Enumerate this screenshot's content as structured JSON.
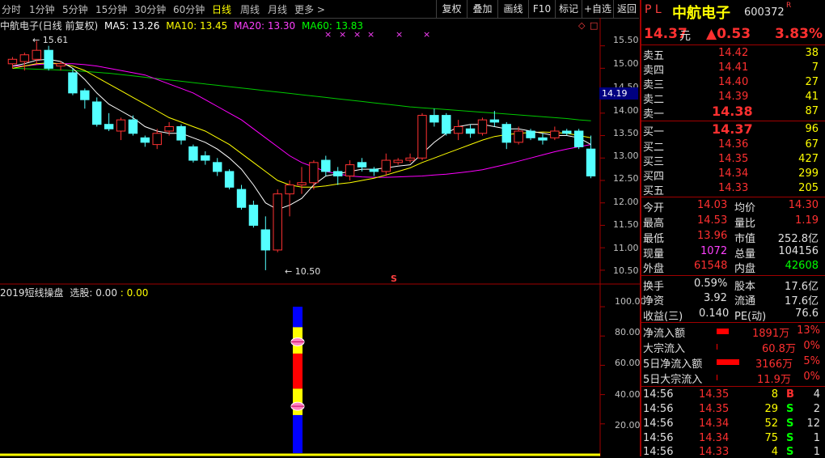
{
  "toolbar": {
    "periods": [
      "分时",
      "1分钟",
      "5分钟",
      "15分钟",
      "30分钟",
      "60分钟",
      "日线",
      "周线",
      "月线",
      "更多 >"
    ],
    "active_period": "日线",
    "buttons": [
      "复权",
      "叠加",
      "画线",
      "F10",
      "标记",
      "+自选",
      "返回"
    ]
  },
  "header": {
    "title": "中航电子(日线 前复权)",
    "ma5": "MA5: 13.26",
    "ma10": "MA10: 13.45",
    "ma20": "MA20: 13.30",
    "ma60": "MA60: 13.83",
    "colors": {
      "ma5": "#ffffff",
      "ma10": "#ffff00",
      "ma20": "#ff00ff",
      "ma60": "#00ff00"
    }
  },
  "chart_data": [
    {
      "type": "candlestick",
      "title": "中航电子(日线 前复权)",
      "ylim": [
        10.3,
        15.8
      ],
      "yticks": [
        10.5,
        11.0,
        11.5,
        12.0,
        12.5,
        13.0,
        13.5,
        14.0,
        14.5,
        15.0,
        15.5
      ],
      "current_price_marker": "14.19",
      "high_label": "15.61",
      "low_label": "10.50",
      "signal_marks": [
        "×",
        "×",
        "×",
        "×",
        "×",
        "×"
      ],
      "s_marker": "S",
      "candles": [
        {
          "o": 15.1,
          "h": 15.25,
          "l": 15.0,
          "c": 15.2
        },
        {
          "o": 15.15,
          "h": 15.35,
          "l": 14.95,
          "c": 15.3
        },
        {
          "o": 15.2,
          "h": 15.61,
          "l": 15.1,
          "c": 15.4
        },
        {
          "o": 15.4,
          "h": 15.5,
          "l": 14.95,
          "c": 15.0
        },
        {
          "o": 15.05,
          "h": 15.15,
          "l": 14.95,
          "c": 15.1
        },
        {
          "o": 14.9,
          "h": 15.0,
          "l": 14.4,
          "c": 14.45
        },
        {
          "o": 14.5,
          "h": 14.55,
          "l": 14.1,
          "c": 14.3
        },
        {
          "o": 14.25,
          "h": 14.35,
          "l": 13.7,
          "c": 13.75
        },
        {
          "o": 13.75,
          "h": 14.0,
          "l": 13.6,
          "c": 13.65
        },
        {
          "o": 13.6,
          "h": 13.9,
          "l": 13.4,
          "c": 13.85
        },
        {
          "o": 13.85,
          "h": 13.95,
          "l": 13.5,
          "c": 13.55
        },
        {
          "o": 13.45,
          "h": 13.5,
          "l": 13.25,
          "c": 13.35
        },
        {
          "o": 13.3,
          "h": 13.65,
          "l": 13.2,
          "c": 13.55
        },
        {
          "o": 13.6,
          "h": 13.8,
          "l": 13.5,
          "c": 13.7
        },
        {
          "o": 13.7,
          "h": 13.75,
          "l": 13.3,
          "c": 13.4
        },
        {
          "o": 13.25,
          "h": 13.3,
          "l": 12.9,
          "c": 12.95
        },
        {
          "o": 13.05,
          "h": 13.15,
          "l": 12.85,
          "c": 12.95
        },
        {
          "o": 12.9,
          "h": 13.0,
          "l": 12.6,
          "c": 12.7
        },
        {
          "o": 12.7,
          "h": 12.75,
          "l": 12.3,
          "c": 12.35
        },
        {
          "o": 12.3,
          "h": 12.4,
          "l": 11.85,
          "c": 11.9
        },
        {
          "o": 11.95,
          "h": 12.05,
          "l": 11.45,
          "c": 11.5
        },
        {
          "o": 11.4,
          "h": 11.7,
          "l": 10.5,
          "c": 10.95
        },
        {
          "o": 10.95,
          "h": 12.3,
          "l": 10.9,
          "c": 12.2
        },
        {
          "o": 12.2,
          "h": 12.5,
          "l": 11.7,
          "c": 12.4
        },
        {
          "o": 12.4,
          "h": 12.8,
          "l": 12.2,
          "c": 12.45
        },
        {
          "o": 12.45,
          "h": 12.95,
          "l": 12.3,
          "c": 12.9
        },
        {
          "o": 12.95,
          "h": 13.05,
          "l": 12.6,
          "c": 12.7
        },
        {
          "o": 12.7,
          "h": 12.8,
          "l": 12.4,
          "c": 12.6
        },
        {
          "o": 12.6,
          "h": 12.95,
          "l": 12.5,
          "c": 12.85
        },
        {
          "o": 12.9,
          "h": 13.0,
          "l": 12.7,
          "c": 12.8
        },
        {
          "o": 12.75,
          "h": 12.8,
          "l": 12.6,
          "c": 12.7
        },
        {
          "o": 12.7,
          "h": 13.1,
          "l": 12.6,
          "c": 12.95
        },
        {
          "o": 12.9,
          "h": 13.0,
          "l": 12.85,
          "c": 12.95
        },
        {
          "o": 12.95,
          "h": 13.1,
          "l": 12.9,
          "c": 13.0
        },
        {
          "o": 13.0,
          "h": 14.0,
          "l": 12.95,
          "c": 13.95
        },
        {
          "o": 13.95,
          "h": 14.1,
          "l": 13.7,
          "c": 13.8
        },
        {
          "o": 13.95,
          "h": 14.0,
          "l": 13.5,
          "c": 13.55
        },
        {
          "o": 13.55,
          "h": 13.85,
          "l": 13.4,
          "c": 13.7
        },
        {
          "o": 13.65,
          "h": 13.75,
          "l": 13.45,
          "c": 13.55
        },
        {
          "o": 13.55,
          "h": 13.9,
          "l": 13.5,
          "c": 13.85
        },
        {
          "o": 13.85,
          "h": 14.05,
          "l": 13.7,
          "c": 13.8
        },
        {
          "o": 13.75,
          "h": 13.8,
          "l": 13.2,
          "c": 13.35
        },
        {
          "o": 13.35,
          "h": 13.7,
          "l": 13.3,
          "c": 13.6
        },
        {
          "o": 13.6,
          "h": 13.65,
          "l": 13.4,
          "c": 13.45
        },
        {
          "o": 13.45,
          "h": 13.55,
          "l": 13.3,
          "c": 13.4
        },
        {
          "o": 13.45,
          "h": 13.7,
          "l": 13.4,
          "c": 13.6
        },
        {
          "o": 13.6,
          "h": 13.65,
          "l": 13.5,
          "c": 13.55
        },
        {
          "o": 13.6,
          "h": 13.65,
          "l": 13.2,
          "c": 13.25
        },
        {
          "o": 13.2,
          "h": 13.5,
          "l": 12.55,
          "c": 12.6
        }
      ],
      "ma5": [
        15.05,
        15.1,
        15.18,
        15.2,
        15.15,
        15.0,
        14.75,
        14.45,
        14.2,
        14.05,
        13.9,
        13.7,
        13.6,
        13.55,
        13.55,
        13.45,
        13.35,
        13.2,
        13.0,
        12.75,
        12.4,
        12.0,
        11.85,
        11.95,
        12.1,
        12.4,
        12.6,
        12.65,
        12.7,
        12.75,
        12.75,
        12.78,
        12.82,
        12.85,
        13.1,
        13.35,
        13.55,
        13.7,
        13.75,
        13.75,
        13.7,
        13.65,
        13.65,
        13.6,
        13.55,
        13.5,
        13.5,
        13.45,
        13.3
      ],
      "ma10": [
        15.0,
        15.05,
        15.1,
        15.12,
        15.1,
        15.05,
        14.95,
        14.8,
        14.65,
        14.5,
        14.35,
        14.2,
        14.05,
        13.9,
        13.8,
        13.7,
        13.6,
        13.45,
        13.3,
        13.1,
        12.9,
        12.7,
        12.5,
        12.4,
        12.35,
        12.35,
        12.38,
        12.42,
        12.45,
        12.5,
        12.55,
        12.62,
        12.7,
        12.78,
        12.9,
        13.0,
        13.1,
        13.2,
        13.3,
        13.4,
        13.48,
        13.52,
        13.55,
        13.57,
        13.58,
        13.57,
        13.55,
        13.5,
        13.45
      ],
      "ma20": [
        15.05,
        15.05,
        15.08,
        15.1,
        15.1,
        15.1,
        15.08,
        15.05,
        15.0,
        14.95,
        14.9,
        14.85,
        14.75,
        14.65,
        14.55,
        14.45,
        14.3,
        14.15,
        14.0,
        13.85,
        13.65,
        13.45,
        13.25,
        13.05,
        12.9,
        12.8,
        12.7,
        12.65,
        12.6,
        12.58,
        12.57,
        12.57,
        12.58,
        12.59,
        12.6,
        12.62,
        12.64,
        12.67,
        12.7,
        12.74,
        12.8,
        12.86,
        12.93,
        13.0,
        13.07,
        13.14,
        13.2,
        13.25,
        13.3
      ],
      "ma60": [
        15.0,
        14.99,
        14.98,
        14.97,
        14.96,
        14.95,
        14.93,
        14.91,
        14.89,
        14.86,
        14.83,
        14.8,
        14.77,
        14.74,
        14.71,
        14.68,
        14.65,
        14.62,
        14.59,
        14.56,
        14.53,
        14.5,
        14.47,
        14.44,
        14.41,
        14.38,
        14.35,
        14.32,
        14.29,
        14.26,
        14.23,
        14.2,
        14.17,
        14.14,
        14.12,
        14.1,
        14.08,
        14.06,
        14.04,
        14.02,
        14.0,
        13.98,
        13.96,
        13.94,
        13.92,
        13.9,
        13.88,
        13.85,
        13.83
      ]
    },
    {
      "type": "bar",
      "title": "2019短线操盘",
      "ylim": [
        0,
        105
      ],
      "yticks": [
        20.0,
        40.0,
        60.0,
        80.0,
        100.0
      ]
    }
  ],
  "indicator": {
    "name": "2019短线操盘",
    "sel_label": "选股: 0.00",
    "sel_extra": ": 0.00",
    "y_labels": [
      "100.00",
      "80.00",
      "60.00",
      "40.00",
      "20.00"
    ]
  },
  "axis": {
    "y_labels": [
      "15.50",
      "15.00",
      "14.50",
      "14.00",
      "13.50",
      "13.00",
      "12.50",
      "12.00",
      "11.50",
      "11.00",
      "10.50"
    ]
  },
  "quote": {
    "name": "中航电子",
    "pl": "P L",
    "code": "600372",
    "code_tag": "R",
    "price": "14.37",
    "unit": "元",
    "change": "▲0.53",
    "change_pct": "3.83%",
    "asks": [
      {
        "label": "卖五",
        "price": "14.42",
        "vol": "38"
      },
      {
        "label": "卖四",
        "price": "14.41",
        "vol": "7"
      },
      {
        "label": "卖三",
        "price": "14.40",
        "vol": "27"
      },
      {
        "label": "卖二",
        "price": "14.39",
        "vol": "41"
      },
      {
        "label": "卖一",
        "price": "14.38",
        "vol": "87"
      }
    ],
    "bids": [
      {
        "label": "买一",
        "price": "14.37",
        "vol": "96"
      },
      {
        "label": "买二",
        "price": "14.36",
        "vol": "67"
      },
      {
        "label": "买三",
        "price": "14.35",
        "vol": "427"
      },
      {
        "label": "买四",
        "price": "14.34",
        "vol": "299"
      },
      {
        "label": "买五",
        "price": "14.33",
        "vol": "205"
      }
    ],
    "stats": [
      {
        "l1": "今开",
        "v1": "14.03",
        "l2": "均价",
        "v2": "14.30",
        "c1": "#ff3030",
        "c2": "#ff3030"
      },
      {
        "l1": "最高",
        "v1": "14.53",
        "l2": "量比",
        "v2": "1.19",
        "c1": "#ff3030",
        "c2": "#ff3030"
      },
      {
        "l1": "最低",
        "v1": "13.96",
        "l2": "市值",
        "v2": "252.8亿",
        "c1": "#ff3030",
        "c2": "#e0e0e0"
      },
      {
        "l1": "现量",
        "v1": "1072",
        "l2": "总量",
        "v2": "104156",
        "c1": "#ff40ff",
        "c2": "#e0e0e0"
      },
      {
        "l1": "外盘",
        "v1": "61548",
        "l2": "内盘",
        "v2": "42608",
        "c1": "#ff3030",
        "c2": "#00ff00"
      }
    ],
    "fin": [
      {
        "l1": "换手",
        "v1": "0.59%",
        "l2": "股本",
        "v2": "17.6亿"
      },
      {
        "l1": "净资",
        "v1": "3.92",
        "l2": "流通",
        "v2": "17.6亿"
      },
      {
        "l1": "收益(三)",
        "v1": "0.140",
        "l2": "PE(动)",
        "v2": "76.6"
      }
    ],
    "flows": [
      {
        "label": "净流入额",
        "bar": 0.3,
        "value": "1891万",
        "pct": "13%"
      },
      {
        "label": "大宗流入",
        "bar": 0.02,
        "value": "60.8万",
        "pct": "0%"
      },
      {
        "label": "5日净流入额",
        "bar": 0.55,
        "value": "3166万",
        "pct": "5%"
      },
      {
        "label": "5日大宗流入",
        "bar": 0.01,
        "value": "11.9万",
        "pct": "0%"
      }
    ],
    "ticks": [
      {
        "time": "14:56",
        "price": "14.35",
        "vol": "8",
        "side": "B",
        "n": "4"
      },
      {
        "time": "14:56",
        "price": "14.35",
        "vol": "29",
        "side": "S",
        "n": "2"
      },
      {
        "time": "14:56",
        "price": "14.34",
        "vol": "52",
        "side": "S",
        "n": "12"
      },
      {
        "time": "14:56",
        "price": "14.34",
        "vol": "75",
        "side": "S",
        "n": "1"
      },
      {
        "time": "14:56",
        "price": "14.33",
        "vol": "4",
        "side": "S",
        "n": "1"
      }
    ]
  }
}
